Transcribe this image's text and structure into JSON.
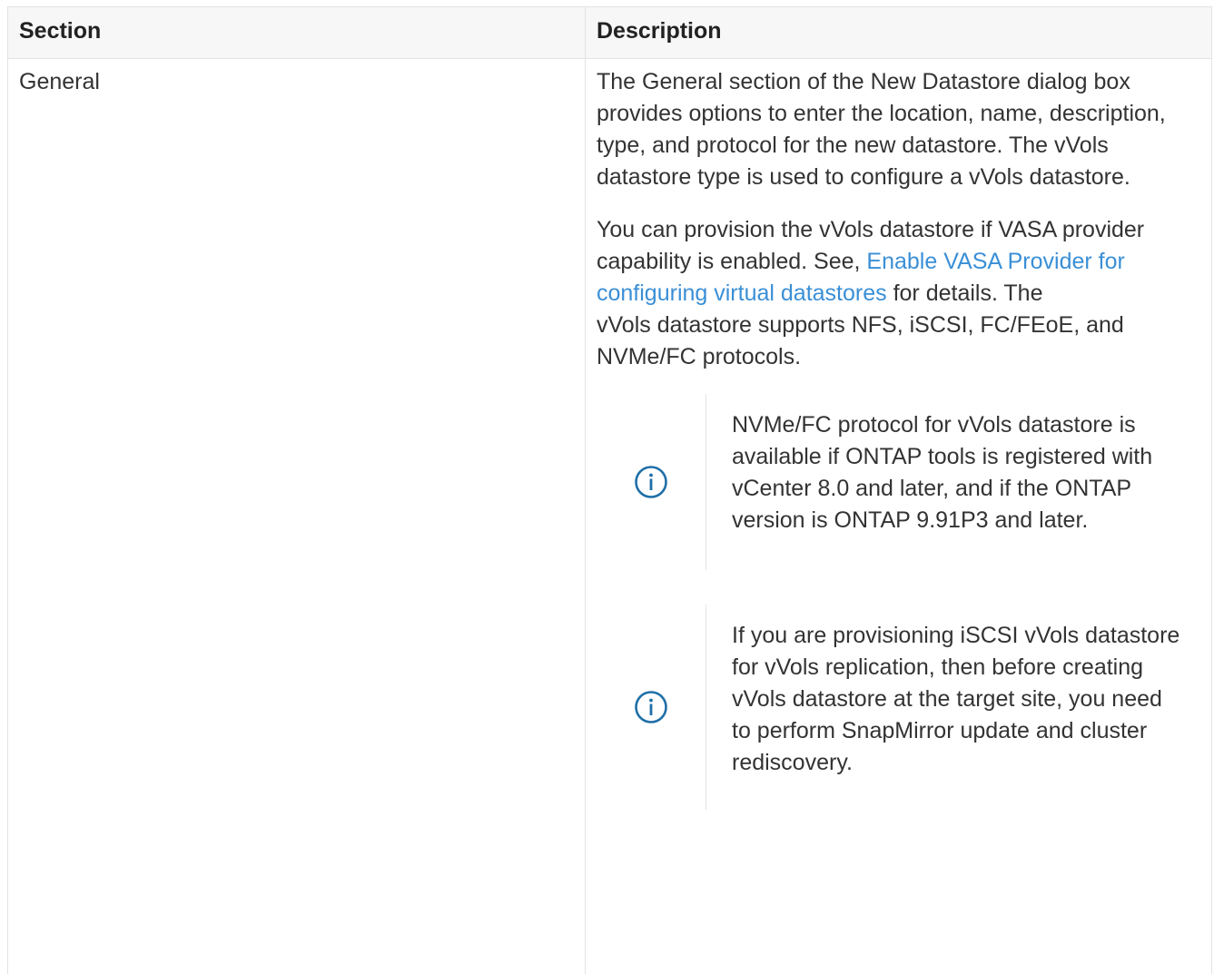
{
  "table": {
    "headers": {
      "section": "Section",
      "description": "Description"
    },
    "rows": [
      {
        "section": "General",
        "description": {
          "para1": "The General section of the New Datastore dialog box provides options to enter the location, name, description, type, and protocol for the new datastore. The vVols datastore type is used to configure a vVols datastore.",
          "para2": {
            "before_link": "You can provision the vVols datastore if VASA provider capability is enabled. See, ",
            "link_text": "Enable VASA Provider for configuring virtual datastores",
            "after_link": " for details. The",
            "next_line": "vVols datastore supports NFS, iSCSI, FC/FEoE, and NVMe/FC protocols."
          },
          "notes": [
            {
              "icon": "info-icon",
              "text": "NVMe/FC protocol for vVols datastore is available if ONTAP tools is registered with vCenter 8.0 and later, and if the ONTAP version is ONTAP 9.91P3 and later."
            },
            {
              "icon": "info-icon",
              "text": "If you are provisioning iSCSI vVols datastore for vVols replication, then before creating vVols datastore at the target site, you need to perform SnapMirror update and cluster rediscovery."
            }
          ]
        }
      }
    ]
  },
  "colors": {
    "text": "#333333",
    "link": "#3a8fd6",
    "border": "#e3e3e3",
    "header_bg": "#f7f7f7",
    "icon": "#1f6fa8"
  }
}
